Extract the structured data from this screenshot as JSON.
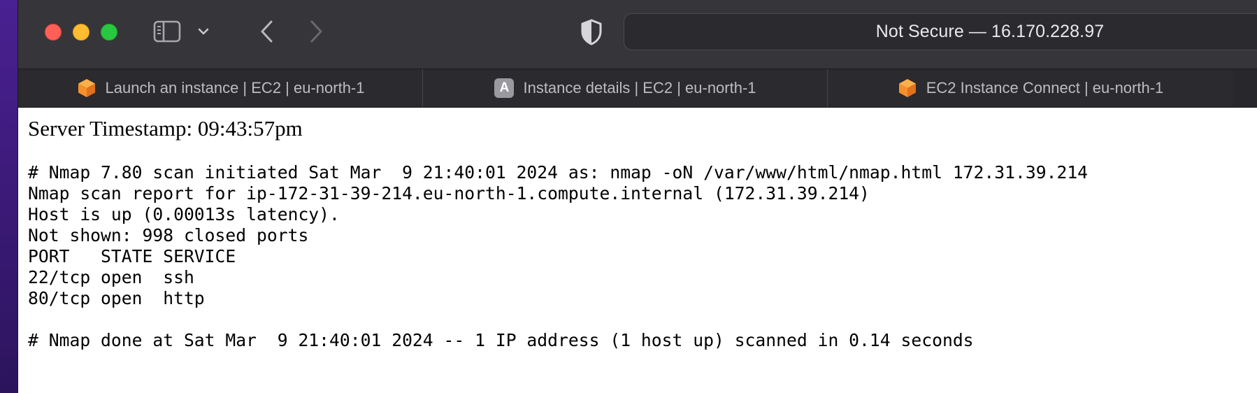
{
  "browser": {
    "address": "Not Secure — 16.170.228.97",
    "tabs": [
      {
        "label": "Launch an instance | EC2 | eu-north-1",
        "icon": "aws-cube-icon"
      },
      {
        "label": "Instance details | EC2 | eu-north-1",
        "icon": "letter-a-icon",
        "icon_text": "A"
      },
      {
        "label": "EC2 Instance Connect | eu-north-1",
        "icon": "aws-cube-icon"
      }
    ],
    "colors": {
      "close": "#fe5f57",
      "minimize": "#febc2e",
      "zoom": "#28c840",
      "aws_orange": "#f7902a"
    }
  },
  "page": {
    "timestamp": "Server Timestamp: 09:43:57pm",
    "lines": [
      "# Nmap 7.80 scan initiated Sat Mar  9 21:40:01 2024 as: nmap -oN /var/www/html/nmap.html 172.31.39.214",
      "Nmap scan report for ip-172-31-39-214.eu-north-1.compute.internal (172.31.39.214)",
      "Host is up (0.00013s latency).",
      "Not shown: 998 closed ports",
      "PORT   STATE SERVICE",
      "22/tcp open  ssh",
      "80/tcp open  http",
      "",
      "# Nmap done at Sat Mar  9 21:40:01 2024 -- 1 IP address (1 host up) scanned in 0.14 seconds"
    ]
  }
}
